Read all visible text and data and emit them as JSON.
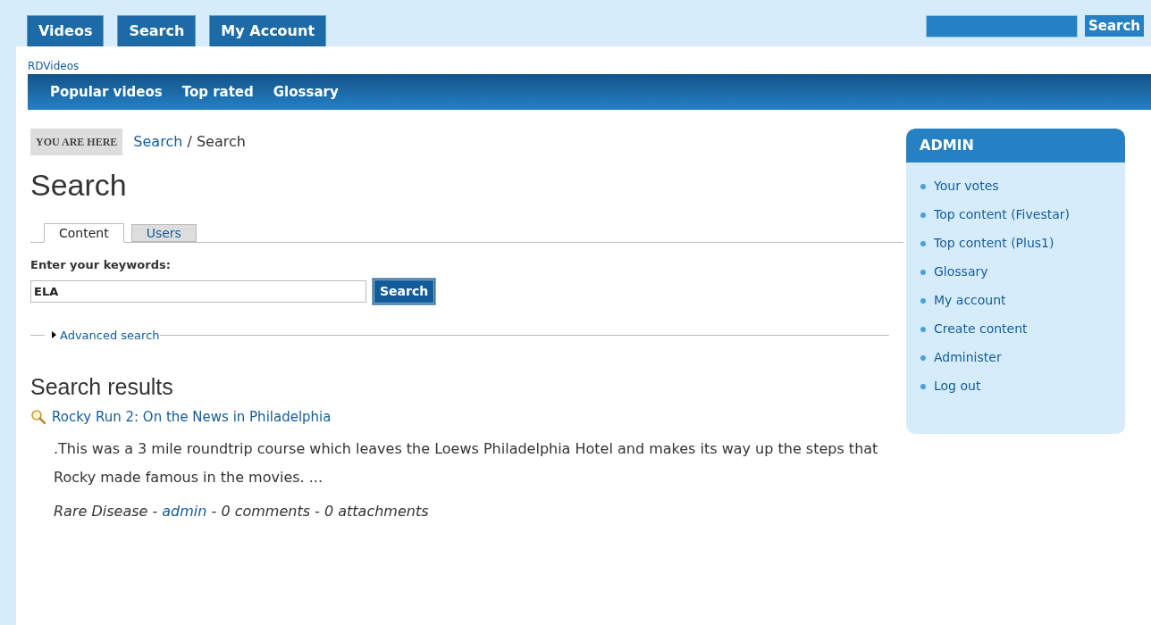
{
  "top_tabs": [
    {
      "label": "Videos"
    },
    {
      "label": "Search"
    },
    {
      "label": "My Account"
    }
  ],
  "top_search": {
    "button": "Search"
  },
  "site_name": "RDVideos",
  "primary_nav": [
    "Popular videos",
    "Top rated",
    "Glossary"
  ],
  "breadcrumb": {
    "label": "YOU ARE HERE",
    "items": [
      {
        "text": "Search",
        "kind": "link"
      },
      {
        "text": " / Search",
        "kind": "text"
      }
    ]
  },
  "page_title": "Search",
  "search_tabs": [
    {
      "label": "Content",
      "selected": true
    },
    {
      "label": "Users",
      "selected": false
    }
  ],
  "form": {
    "label": "Enter your keywords:",
    "value": "ELA",
    "button": "Search"
  },
  "advanced": {
    "label": "Advanced search",
    "expanded": false
  },
  "results": {
    "heading": "Search results",
    "items": [
      {
        "title": "Rocky Run 2: On the News in Philadelphia",
        "snippet": ".This was a 3 mile roundtrip course which leaves the Loews Philadelphia Hotel and makes its way up the steps that Rocky made famous in the movies. ...",
        "meta": [
          {
            "kind": "text",
            "text": "Rare Disease - "
          },
          {
            "kind": "link",
            "text": "admin"
          },
          {
            "kind": "text",
            "text": " - 0 comments - 0 attachments"
          }
        ]
      }
    ]
  },
  "sidebar": {
    "title": "ADMIN",
    "items": [
      "Your votes",
      "Top content (Fivestar)",
      "Top content (Plus1)",
      "Glossary",
      "My account",
      "Create content",
      "Administer",
      "Log out"
    ]
  }
}
